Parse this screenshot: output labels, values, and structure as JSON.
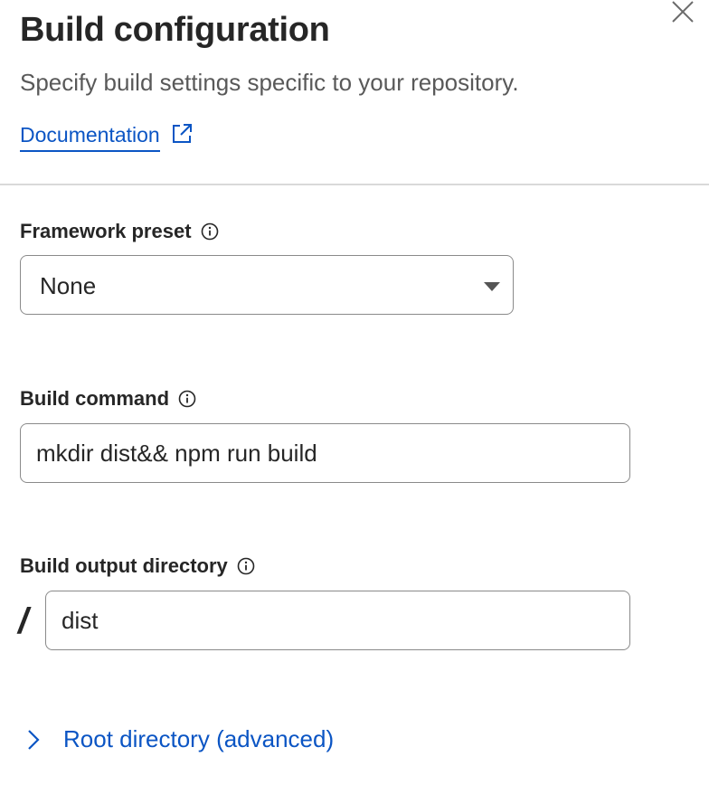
{
  "panel": {
    "title": "Build configuration",
    "subtitle": "Specify build settings specific to your repository.",
    "doc_link_label": "Documentation"
  },
  "framework_preset": {
    "label": "Framework preset",
    "selected": "None"
  },
  "build_command": {
    "label": "Build command",
    "value": "mkdir dist&& npm run build"
  },
  "build_output": {
    "label": "Build output directory",
    "prefix": "/",
    "value": "dist"
  },
  "root_directory": {
    "label": "Root directory (advanced)"
  },
  "icons": {
    "close": "close-icon",
    "external_link": "external-link-icon",
    "info": "info-icon",
    "caret": "caret-down-icon",
    "chevron": "chevron-right-icon"
  },
  "colors": {
    "link": "#0b55c4",
    "heading": "#262626",
    "muted": "#595959",
    "border": "#8a8a8a"
  }
}
